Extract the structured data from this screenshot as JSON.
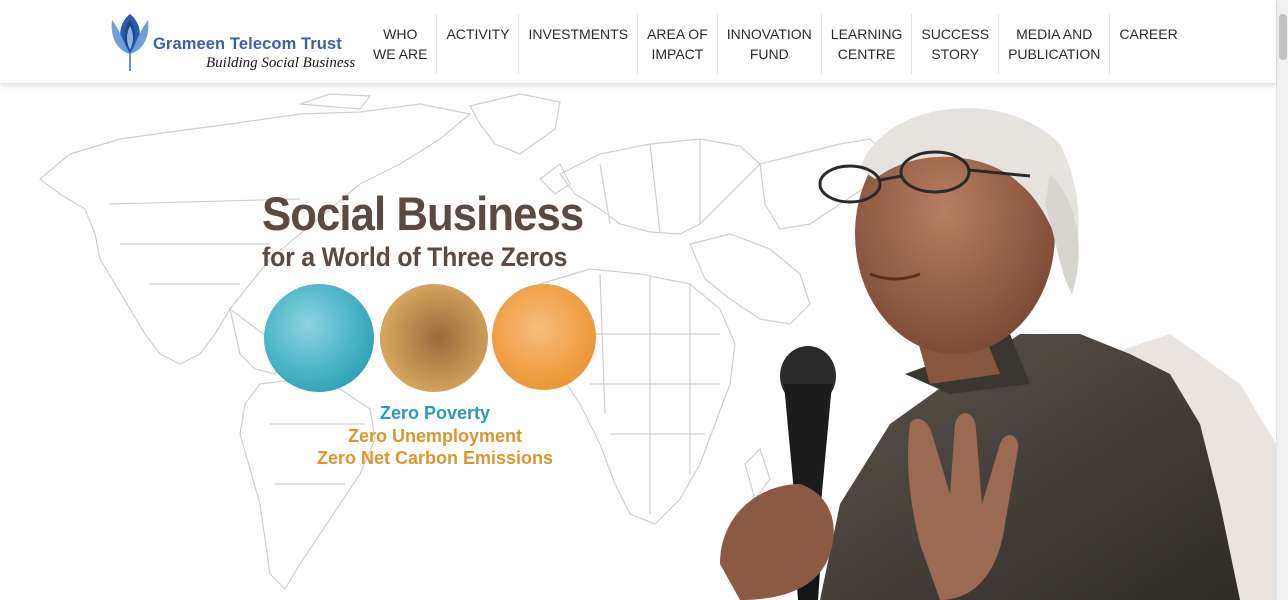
{
  "header": {
    "logo": {
      "title": "Grameen Telecom Trust",
      "tagline": "Building Social Business",
      "icon": "lotus-icon",
      "colors": {
        "petal_dark": "#1f4f9c",
        "petal_mid": "#3e78c4",
        "petal_light": "#8ab4e6"
      }
    },
    "nav": [
      {
        "line1": "WHO",
        "line2": "WE ARE"
      },
      {
        "line1": "ACTIVITY",
        "line2": ""
      },
      {
        "line1": "INVESTMENTS",
        "line2": ""
      },
      {
        "line1": "AREA OF",
        "line2": "IMPACT"
      },
      {
        "line1": "INNOVATION",
        "line2": "FUND"
      },
      {
        "line1": "LEARNING",
        "line2": "CENTRE"
      },
      {
        "line1": "SUCCESS",
        "line2": "STORY"
      },
      {
        "line1": "MEDIA AND",
        "line2": "PUBLICATION"
      },
      {
        "line1": "CAREER",
        "line2": ""
      }
    ]
  },
  "hero": {
    "headline": "Social Business",
    "subheadline": "for a World of Three Zeros",
    "zeros": [
      "Zero Poverty",
      "Zero Unemployment",
      "Zero Net Carbon Emissions"
    ],
    "colors": {
      "headline": "#5a4a42",
      "zero_poverty": "#2a9bb1",
      "zero_unemployment": "#d9962f",
      "zero_carbon": "#dd962e",
      "orb_blue": "#4fb8c8",
      "orb_brown": "#b9874c",
      "orb_orange": "#f0a24a"
    }
  }
}
